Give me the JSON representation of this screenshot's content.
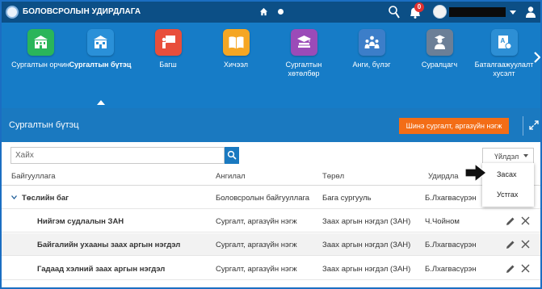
{
  "header": {
    "app_title": "БОЛОВСРОЛЫН УДИРДЛАГА",
    "notification_count": "0",
    "username": ""
  },
  "modules": [
    {
      "label": "Сургалтын орчин",
      "icon": "school-building-icon",
      "color": "#2ab55a"
    },
    {
      "label": "Сургалтын бүтэц",
      "icon": "organization-structure-icon",
      "color": "#2a90d8",
      "active": true
    },
    {
      "label": "Багш",
      "icon": "teacher-board-icon",
      "color": "#e84e3b"
    },
    {
      "label": "Хичээл",
      "icon": "open-book-icon",
      "color": "#f5a623"
    },
    {
      "label": "Сургалтын хөтөлбөр",
      "icon": "graduation-books-icon",
      "color": "#9b4bb8"
    },
    {
      "label": "Анги, бүлэг",
      "icon": "class-group-icon",
      "color": "#3c7ec9"
    },
    {
      "label": "Суралцагч",
      "icon": "student-icon",
      "color": "#6b7f97"
    },
    {
      "label": "Баталгаажуулалт хусэлт",
      "icon": "approval-document-icon",
      "color": "#2d8fd5"
    }
  ],
  "page": {
    "title": "Сургалтын бүтэц",
    "add_button": "Шинэ сургалт, аргазүйн нэгж"
  },
  "search": {
    "placeholder": "Хайх",
    "value": ""
  },
  "actions": {
    "select_label": "Үйлдэл",
    "menu": [
      "Засах",
      "Устгах"
    ]
  },
  "table": {
    "columns": [
      "Байгууллага",
      "Ангилал",
      "Төрөл",
      "Удирдла"
    ],
    "rows": [
      {
        "name": "Төслийн баг",
        "category": "Боловсролын байгууллага",
        "type": "Бага сургууль",
        "manager": "Б.Лхагвасүрэн",
        "group": true
      },
      {
        "name": "Нийгэм судлалын ЗАН",
        "category": "Сургалт, аргазүйн нэгж",
        "type": "Заах аргын нэгдэл (ЗАН)",
        "manager": "Ч.Чойном"
      },
      {
        "name": "Байгалийн ухааны заах аргын нэгдэл",
        "category": "Сургалт, аргазүйн нэгж",
        "type": "Заах аргын нэгдэл (ЗАН)",
        "manager": "Б.Лхагвасүрэн"
      },
      {
        "name": "Гадаад хэлний заах аргын нэгдэл",
        "category": "Сургалт, аргазүйн нэгж",
        "type": "Заах аргын нэгдэл (ЗАН)",
        "manager": "Б.Лхагвасүрэн"
      }
    ]
  },
  "colors": {
    "header_bg": "#0c4f86",
    "module_bar_bg": "#167cc7",
    "accent_orange": "#f36d16",
    "link_blue": "#1f5e99"
  }
}
